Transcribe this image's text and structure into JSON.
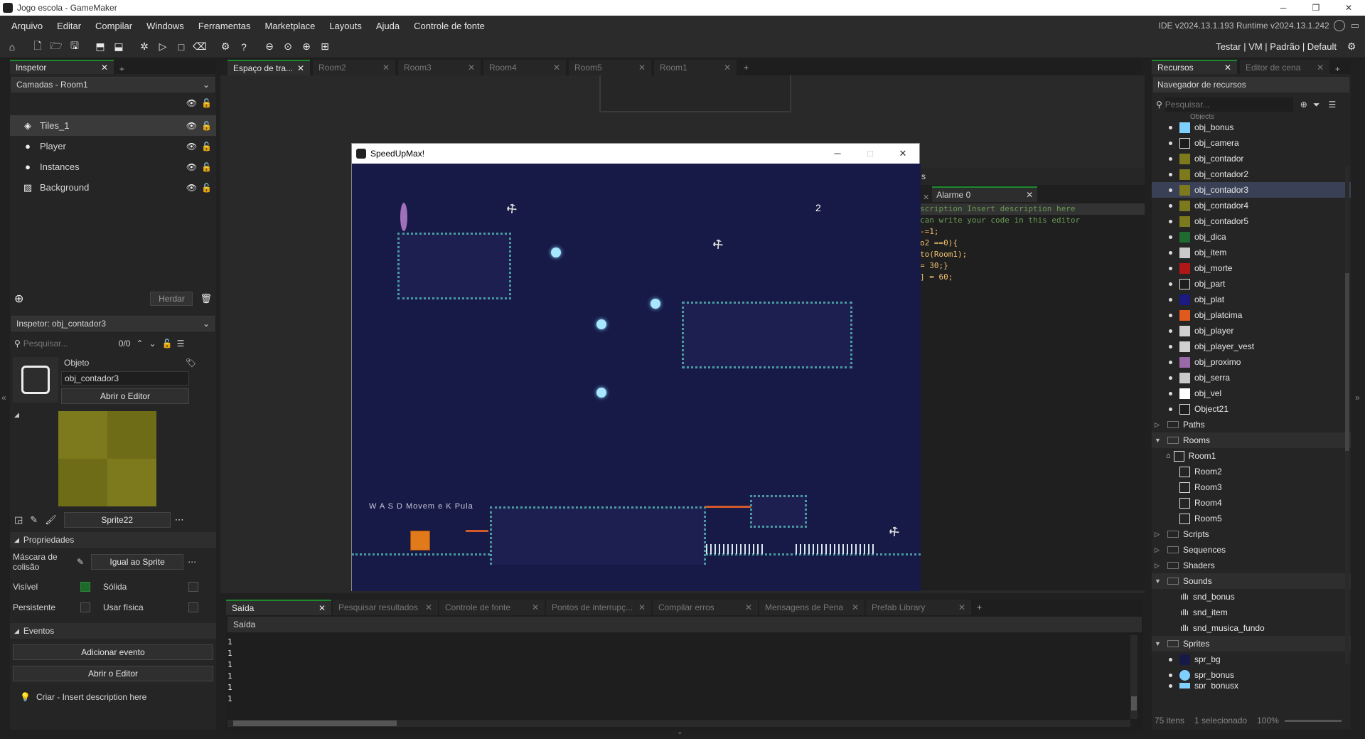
{
  "window": {
    "title": "Jogo escola - GameMaker",
    "minimize": "─",
    "restore": "❐",
    "close": "✕"
  },
  "menu": {
    "items": [
      "Arquivo",
      "Editar",
      "Compilar",
      "Windows",
      "Ferramentas",
      "Marketplace",
      "Layouts",
      "Ajuda",
      "Controle de fonte"
    ],
    "version": "IDE v2024.13.1.193  Runtime v2024.13.1.242"
  },
  "toolbar": {
    "targets": "Testar | VM | Padrão | Default"
  },
  "inspector": {
    "tab": "Inspetor",
    "layers_dropdown": "Camadas - Room1",
    "layers": [
      {
        "name": "Tiles_1",
        "icon": "tiles-icon"
      },
      {
        "name": "Player",
        "icon": "instance-icon"
      },
      {
        "name": "Instances",
        "icon": "instance-icon"
      },
      {
        "name": "Background",
        "icon": "background-icon"
      }
    ],
    "inherit": "Herdar",
    "obj_dropdown": "Inspetor: obj_contador3",
    "search_placeholder": "Pesquisar...",
    "search_count": "0/0",
    "object_label": "Objeto",
    "object_name": "obj_contador3",
    "open_editor": "Abrir o Editor",
    "sprite_name": "Sprite22",
    "properties": "Propriedades",
    "mask_label_1": "Máscara de",
    "mask_label_2": "colisão",
    "mask_value": "Igual ao Sprite",
    "visible": "Visível",
    "solid": "Sólida",
    "persistent": "Persistente",
    "physics": "Usar física",
    "events": "Eventos",
    "add_event": "Adicionar evento",
    "open_editor2": "Abrir o Editor",
    "create_event": "Criar - Insert description here",
    "visible_checked": true,
    "solid_checked": false,
    "persistent_checked": false,
    "physics_checked": false
  },
  "room_tabs": [
    "Espaço de tra...",
    "Room2",
    "Room3",
    "Room4",
    "Room5",
    "Room1"
  ],
  "game": {
    "title": "SpeedUpMax!",
    "score": "2",
    "hint": "W A S D Movem e K Pula"
  },
  "code": {
    "tab": "Alarme 0",
    "header_fragment": "s",
    "lines": [
      "scription Insert description here",
      "can write your code in this editor",
      "-=1;",
      "o2 ==0){",
      "to(Room1);",
      "= 30;}",
      "] = 60;"
    ]
  },
  "output": {
    "tabs": [
      "Saída",
      "Pesquisar resultados",
      "Controle de fonte",
      "Pontos de interrupç...",
      "Compilar erros",
      "Mensagens de Pena",
      "Prefab Library"
    ],
    "header": "Saída",
    "lines": [
      "1",
      "1",
      "1",
      "1",
      "1",
      "1"
    ]
  },
  "assets": {
    "tabs": [
      "Recursos",
      "Editor de cena"
    ],
    "header": "Navegador de recursos",
    "search_placeholder": "Pesquisar...",
    "objects_folder": "Objects",
    "objects": [
      {
        "name": "obj_bonus",
        "color": "#7fd0ff"
      },
      {
        "name": "obj_camera",
        "color": "#1d1d1d"
      },
      {
        "name": "obj_contador",
        "color": "#7c7a1c"
      },
      {
        "name": "obj_contador2",
        "color": "#7c7a1c"
      },
      {
        "name": "obj_contador3",
        "color": "#7c7a1c"
      },
      {
        "name": "obj_contador4",
        "color": "#7c7a1c"
      },
      {
        "name": "obj_contador5",
        "color": "#7c7a1c"
      },
      {
        "name": "obj_dica",
        "color": "#1e6a30"
      },
      {
        "name": "obj_item",
        "color": "#c9c9c9"
      },
      {
        "name": "obj_morte",
        "color": "#b01818"
      },
      {
        "name": "obj_part",
        "color": "#1d1d1d"
      },
      {
        "name": "obj_plat",
        "color": "#1a1a80"
      },
      {
        "name": "obj_platcima",
        "color": "#e05a1e"
      },
      {
        "name": "obj_player",
        "color": "#d0d0d0"
      },
      {
        "name": "obj_player_vest",
        "color": "#d0d0d0"
      },
      {
        "name": "obj_proximo",
        "color": "#9a6aa8"
      },
      {
        "name": "obj_serra",
        "color": "#c9c9c9"
      },
      {
        "name": "obj_vel",
        "color": "#ffffff"
      },
      {
        "name": "Object21",
        "color": "#1d1d1d"
      }
    ],
    "paths": "Paths",
    "rooms_folder": "Rooms",
    "rooms": [
      "Room1",
      "Room2",
      "Room3",
      "Room4",
      "Room5"
    ],
    "scripts": "Scripts",
    "sequences": "Sequences",
    "shaders": "Shaders",
    "sounds_folder": "Sounds",
    "sounds": [
      "snd_bonus",
      "snd_item",
      "snd_musica_fundo"
    ],
    "sprites_folder": "Sprites",
    "sprites": [
      {
        "name": "spr_bg",
        "color": "#171a46"
      },
      {
        "name": "spr_bonus",
        "color": "#7fd0ff"
      },
      {
        "name": "spr_bonusx",
        "color": "#7fd0ff"
      }
    ],
    "status_items": "75 itens",
    "status_selected": "1 selecionado",
    "zoom": "100%"
  }
}
